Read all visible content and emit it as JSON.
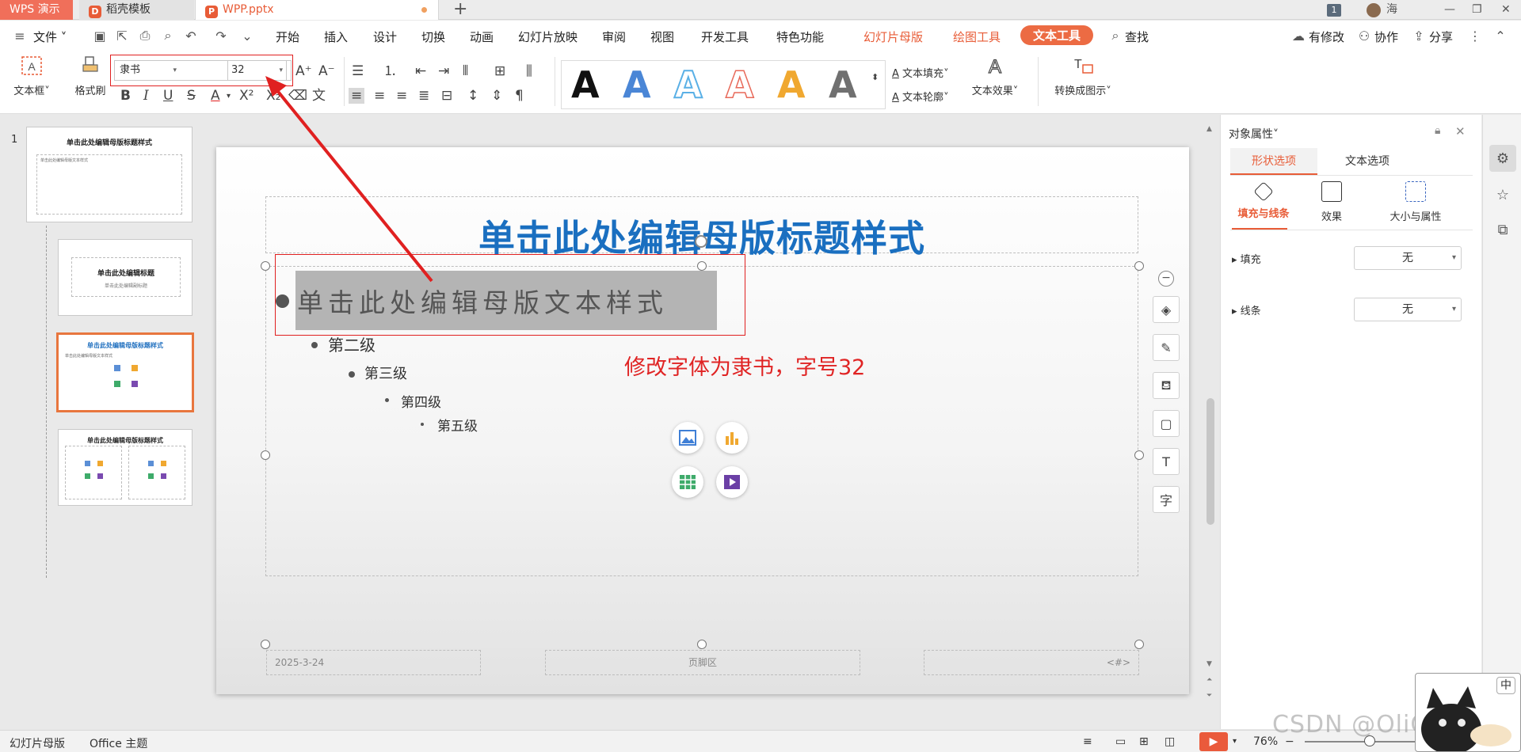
{
  "tabs": {
    "app": "WPS 演示",
    "doc": "稻壳模板",
    "file": "WPP.pptx",
    "add": "+"
  },
  "user": {
    "count": "1",
    "name": "海"
  },
  "menu": {
    "file": "文件",
    "items": [
      "开始",
      "插入",
      "设计",
      "切换",
      "动画",
      "幻灯片放映",
      "审阅",
      "视图",
      "开发工具",
      "特色功能"
    ],
    "context_tabs": [
      "幻灯片母版",
      "绘图工具"
    ],
    "active_tab": "文本工具",
    "search": "查找",
    "right": [
      "有修改",
      "协作",
      "分享"
    ]
  },
  "toolbar": {
    "textbox": "文本框",
    "format_painter": "格式刷",
    "font": "隶书",
    "size": "32",
    "text_fill": "文本填充",
    "text_outline": "文本轮廓",
    "text_effect": "文本效果",
    "convert": "转换成图示",
    "style_letter": "A",
    "style_colors": [
      "#111111",
      "#4a86d6",
      "#5ab0e6",
      "#e86a5a",
      "#f0a830",
      "#707070"
    ]
  },
  "thumbnails": {
    "index": "1",
    "master_title": "单击此处编辑母版标题样式",
    "layout_title": "单击此处编辑标题",
    "layout_sub": "单击此处编辑副标题",
    "tiny_text": "单击此处编辑母版文本样式"
  },
  "slide": {
    "title": "单击此处编辑母版标题样式",
    "level1": "单击此处编辑母版文本样式",
    "level2": "第二级",
    "level3": "第三级",
    "level4": "第四级",
    "level5": "第五级",
    "annotation": "修改字体为隶书，字号32",
    "footer_date": "2025-3-24",
    "footer_text": "页脚区",
    "footer_num": "<#>"
  },
  "panel": {
    "title": "对象属性",
    "tab_shape": "形状选项",
    "tab_text": "文本选项",
    "sub_fill_line": "填充与线条",
    "sub_effect": "效果",
    "sub_size": "大小与属性",
    "fill_label": "填充",
    "fill_value": "无",
    "line_label": "线条",
    "line_value": "无"
  },
  "statusbar": {
    "mode": "幻灯片母版",
    "theme": "Office 主题",
    "zoom": "76%"
  },
  "watermark": "CSDN @OliCorrect",
  "cat_label": "中"
}
